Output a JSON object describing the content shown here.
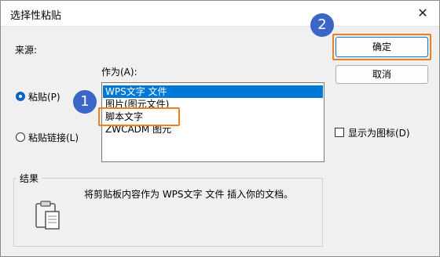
{
  "window": {
    "title": "选择性粘贴",
    "close_glyph": "✕"
  },
  "source": {
    "label": "来源:"
  },
  "as_label": "作为(A):",
  "options": {
    "paste": "粘贴(P)",
    "paste_link": "粘贴链接(L)"
  },
  "list": {
    "items": [
      "WPS文字 文件",
      "图片(图元文件)",
      "脚本文字",
      "ZWCADM 图元"
    ],
    "selected_index": 0
  },
  "buttons": {
    "ok": "确定",
    "cancel": "取消"
  },
  "display_as_icon": "显示为图标(D)",
  "result": {
    "label": "结果",
    "text": "将剪贴板内容作为 WPS文字 文件 插入你的文档。"
  },
  "badges": {
    "one": "1",
    "two": "2"
  },
  "colors": {
    "accent": "#0078d7",
    "highlight": "#f07f1f",
    "badge": "#3a66c8"
  }
}
